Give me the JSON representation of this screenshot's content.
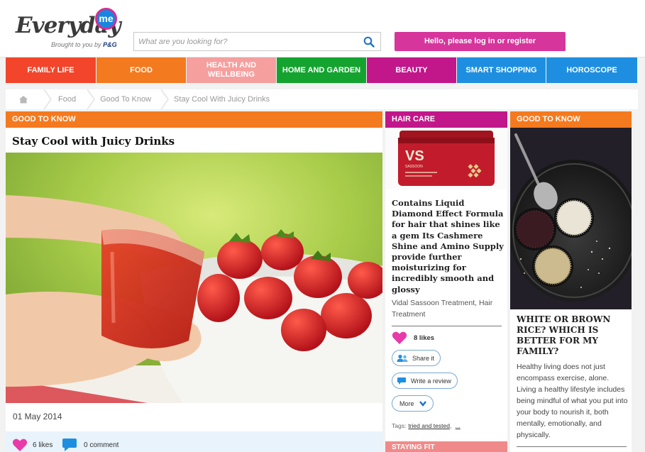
{
  "header": {
    "logo_word": "Everyday",
    "logo_badge": "me",
    "logo_tagline": "Brought to you by",
    "logo_brand": "P&G",
    "search_placeholder": "What are you looking for?",
    "login_label": "Hello, please log in or register"
  },
  "nav": {
    "items": [
      {
        "label": "FAMILY LIFE",
        "color": "#f2452b"
      },
      {
        "label": "FOOD",
        "color": "#f47a1f"
      },
      {
        "label": "HEALTH AND\nWELLBEING",
        "color": "#f59f9f"
      },
      {
        "label": "HOME AND GARDEN",
        "color": "#14a32f"
      },
      {
        "label": "BEAUTY",
        "color": "#c1178a"
      },
      {
        "label": "SMART SHOPPING",
        "color": "#1e8fe0"
      },
      {
        "label": "HOROSCOPE",
        "color": "#1e8fe0"
      }
    ]
  },
  "breadcrumb": {
    "items": [
      "Food",
      "Good To Know",
      "Stay Cool With Juicy Drinks"
    ]
  },
  "article": {
    "category": "GOOD TO KNOW",
    "category_color": "#f47a1f",
    "title": "Stay Cool with Juicy Drinks",
    "date": "01 May 2014",
    "likes": "6 likes",
    "comments": "0 comment"
  },
  "middle": {
    "category": "HAIR CARE",
    "product_brand": "VS",
    "product_sub": "SASSOON",
    "title": "Contains Liquid Diamond Effect Formula for hair that shines like a gem Its Cashmere Shine and Amino Supply provide further moisturizing for incredibly smooth and glossy",
    "subtitle": "Vidal Sassoon Treatment, Hair Treatment",
    "likes": "8 likes",
    "share_label": "Share it",
    "review_label": "Write a review",
    "more_label": "More",
    "tags_label": "Tags:",
    "tag_1": "tried and tested",
    "tag_more": "...",
    "next_category": "STAYING FIT"
  },
  "right": {
    "category": "GOOD TO KNOW",
    "title": "WHITE OR BROWN RICE? WHICH IS BETTER FOR MY FAMILY?",
    "body": "Healthy living does not just encompass exercise, alone. Living a healthy lifestyle includes being mindful of what you put into your body to nourish it, both mentally, emotionally, and physically."
  },
  "colors": {
    "accent_pink": "#d6359c",
    "beauty": "#c1178a",
    "orange": "#f47a1f",
    "blue": "#1e8fe0"
  }
}
